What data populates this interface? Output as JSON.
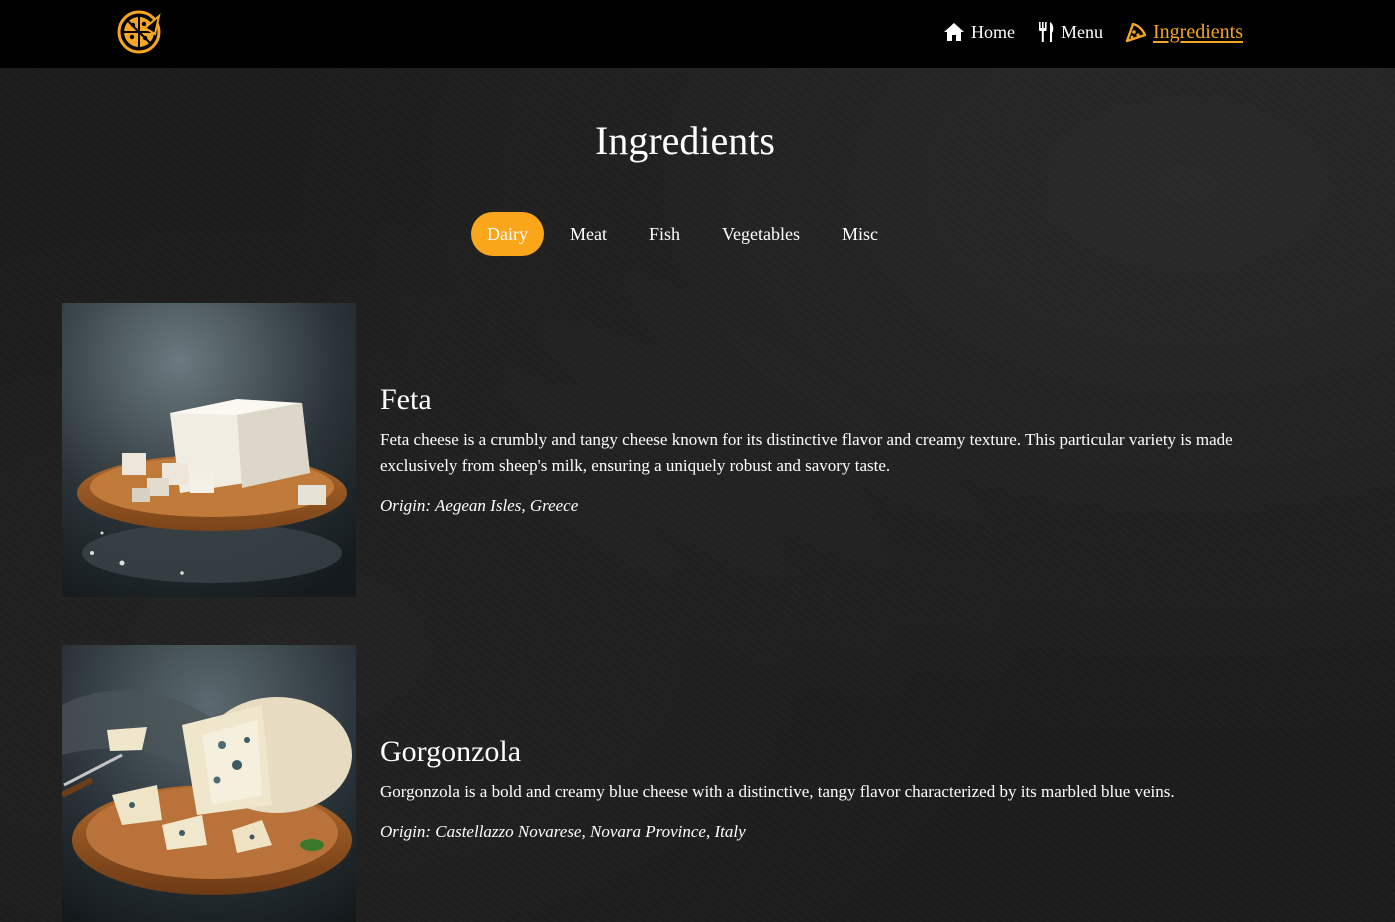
{
  "header": {
    "logo_icon": "pizza-logo-icon",
    "nav": [
      {
        "label": "Home",
        "icon": "home-icon"
      },
      {
        "label": "Menu",
        "icon": "fork-knife-icon"
      },
      {
        "label": "Ingredients",
        "icon": "pizza-slice-icon",
        "active": true
      }
    ]
  },
  "main": {
    "title": "Ingredients",
    "tabs": [
      "Dairy",
      "Meat",
      "Fish",
      "Vegetables",
      "Misc"
    ],
    "active_tab": "Dairy",
    "items": [
      {
        "name": "Feta",
        "description": "Feta cheese is a crumbly and tangy cheese known for its distinctive flavor and creamy texture. This particular variety is made exclusively from sheep's milk, ensuring a uniquely robust and savory taste.",
        "origin": "Origin: Aegean Isles, Greece"
      },
      {
        "name": "Gorgonzola",
        "description": "Gorgonzola is a bold and creamy blue cheese with a distinctive, tangy flavor characterized by its marbled blue veins.",
        "origin": "Origin: Castellazzo Novarese, Novara Province, Italy"
      }
    ]
  },
  "colors": {
    "accent": "#f9a61a",
    "navbar": "#000000",
    "background": "#1c1c1c"
  }
}
